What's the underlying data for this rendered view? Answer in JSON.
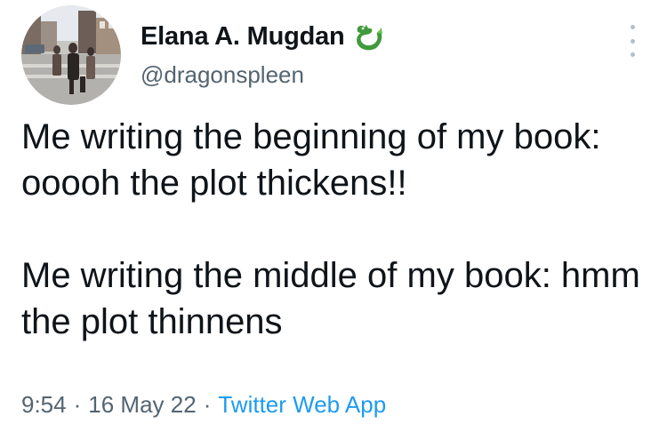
{
  "author": {
    "display_name": "Elana A. Mugdan",
    "handle": "@dragonspleen",
    "name_emoji": "dragon-icon"
  },
  "tweet": {
    "paragraphs": [
      "Me writing the beginning of my book: ooooh the plot thickens!!",
      "Me writing the middle of my book: hmm the plot thinnens"
    ]
  },
  "meta": {
    "time": "9:54",
    "separator": "·",
    "date": "16 May 22",
    "source": "Twitter Web App"
  },
  "colors": {
    "text": "#0f1419",
    "secondary": "#536471",
    "link": "#1d9bf0",
    "dragon": "#3f9a3c"
  }
}
